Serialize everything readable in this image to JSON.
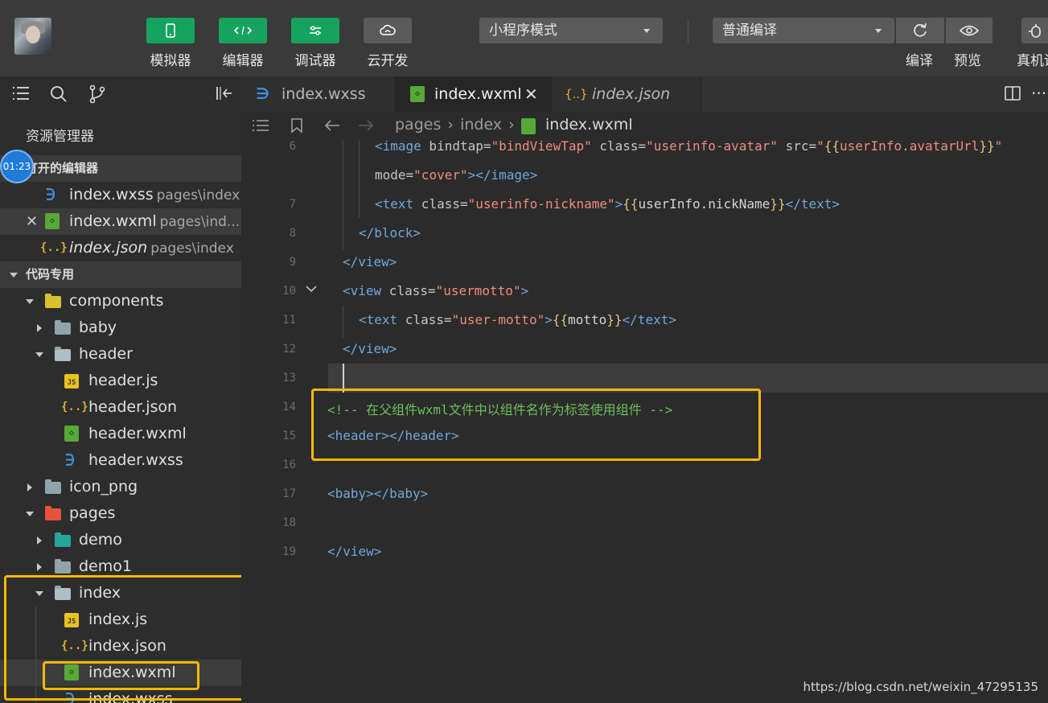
{
  "toolbar": {
    "buttons": [
      {
        "label": "模拟器",
        "icon": "phone-icon"
      },
      {
        "label": "编辑器",
        "icon": "code-icon"
      },
      {
        "label": "调试器",
        "icon": "debug-icon"
      },
      {
        "label": "云开发",
        "icon": "cloud-icon"
      }
    ],
    "mode_select": "小程序模式",
    "compile_select": "普通编译",
    "right_buttons": [
      {
        "label": "编译",
        "icon": "refresh-icon"
      },
      {
        "label": "预览",
        "icon": "eye-icon"
      },
      {
        "label": "真机调",
        "icon": "bug-icon"
      }
    ]
  },
  "sidebar": {
    "title": "资源管理器",
    "open_editors": {
      "header": "打开的编辑器",
      "items": [
        {
          "name": "index.wxss",
          "path": "pages\\index",
          "type": "wxss"
        },
        {
          "name": "index.wxml",
          "path": "pages\\ind...",
          "type": "wxml"
        },
        {
          "name": "index.json",
          "path": "pages\\index",
          "type": "json"
        }
      ]
    },
    "project": {
      "header": "代码专用",
      "tree": {
        "components": "components",
        "baby": "baby",
        "header": "header",
        "header_js": "header.js",
        "header_json": "header.json",
        "header_wxml": "header.wxml",
        "header_wxss": "header.wxss",
        "icon_png": "icon_png",
        "pages": "pages",
        "demo": "demo",
        "demo1": "demo1",
        "index": "index",
        "index_js": "index.js",
        "index_json": "index.json",
        "index_wxml": "index.wxml",
        "index_wxss": "index.wxss"
      }
    }
  },
  "timer": "01:23",
  "tabs": [
    {
      "label": "index.wxss",
      "type": "wxss"
    },
    {
      "label": "index.wxml",
      "type": "wxml",
      "active": true
    },
    {
      "label": "index.json",
      "type": "json"
    }
  ],
  "breadcrumb": {
    "part1": "pages",
    "part2": "index",
    "file": "index.wxml"
  },
  "code": {
    "line_numbers": [
      "6",
      "7",
      "8",
      "9",
      "10",
      "11",
      "12",
      "13",
      "14",
      "15",
      "16",
      "17",
      "18",
      "19"
    ],
    "lines": {
      "l6a_tag_open": "<image",
      "l6a_attr1": " bindtap=",
      "l6a_val1": "\"bindViewTap\"",
      "l6a_attr2": " class=",
      "l6a_val2": "\"userinfo-avatar\"",
      "l6a_attr3": " src=",
      "l6a_val3_q1": "\"",
      "l6a_val3_b1": "{{",
      "l6a_val3_expr": "userInfo.avatarUrl",
      "l6a_val3_b2": "}}",
      "l6a_val3_q2": "\"",
      "l6b_attr": "mode=",
      "l6b_val": "\"cover\"",
      "l6b_tag": "></image>",
      "l7_tag_open": "<text",
      "l7_attr": " class=",
      "l7_val": "\"userinfo-nickname\"",
      "l7_gt": ">",
      "l7_b1": "{{",
      "l7_expr": "userInfo.nickName",
      "l7_b2": "}}",
      "l7_close": "</text>",
      "l8": "</block>",
      "l9": "</view>",
      "l10_tag_open": "<view",
      "l10_attr": " class=",
      "l10_val": "\"usermotto\"",
      "l10_gt": ">",
      "l11_tag_open": "<text",
      "l11_attr": " class=",
      "l11_val": "\"user-motto\"",
      "l11_gt": ">",
      "l11_b1": "{{",
      "l11_expr": "motto",
      "l11_b2": "}}",
      "l11_close": "</text>",
      "l12": "</view>",
      "l14": "<!-- 在父组件wxml文件中以组件名作为标签使用组件 -->",
      "l15": "<header></header>",
      "l17": "<baby></baby>",
      "l19": "</view>"
    }
  },
  "watermark": "https://blog.csdn.net/weixin_47295135",
  "colors": {
    "accent_green": "#15a35e",
    "highlight_box": "#f5b800"
  }
}
